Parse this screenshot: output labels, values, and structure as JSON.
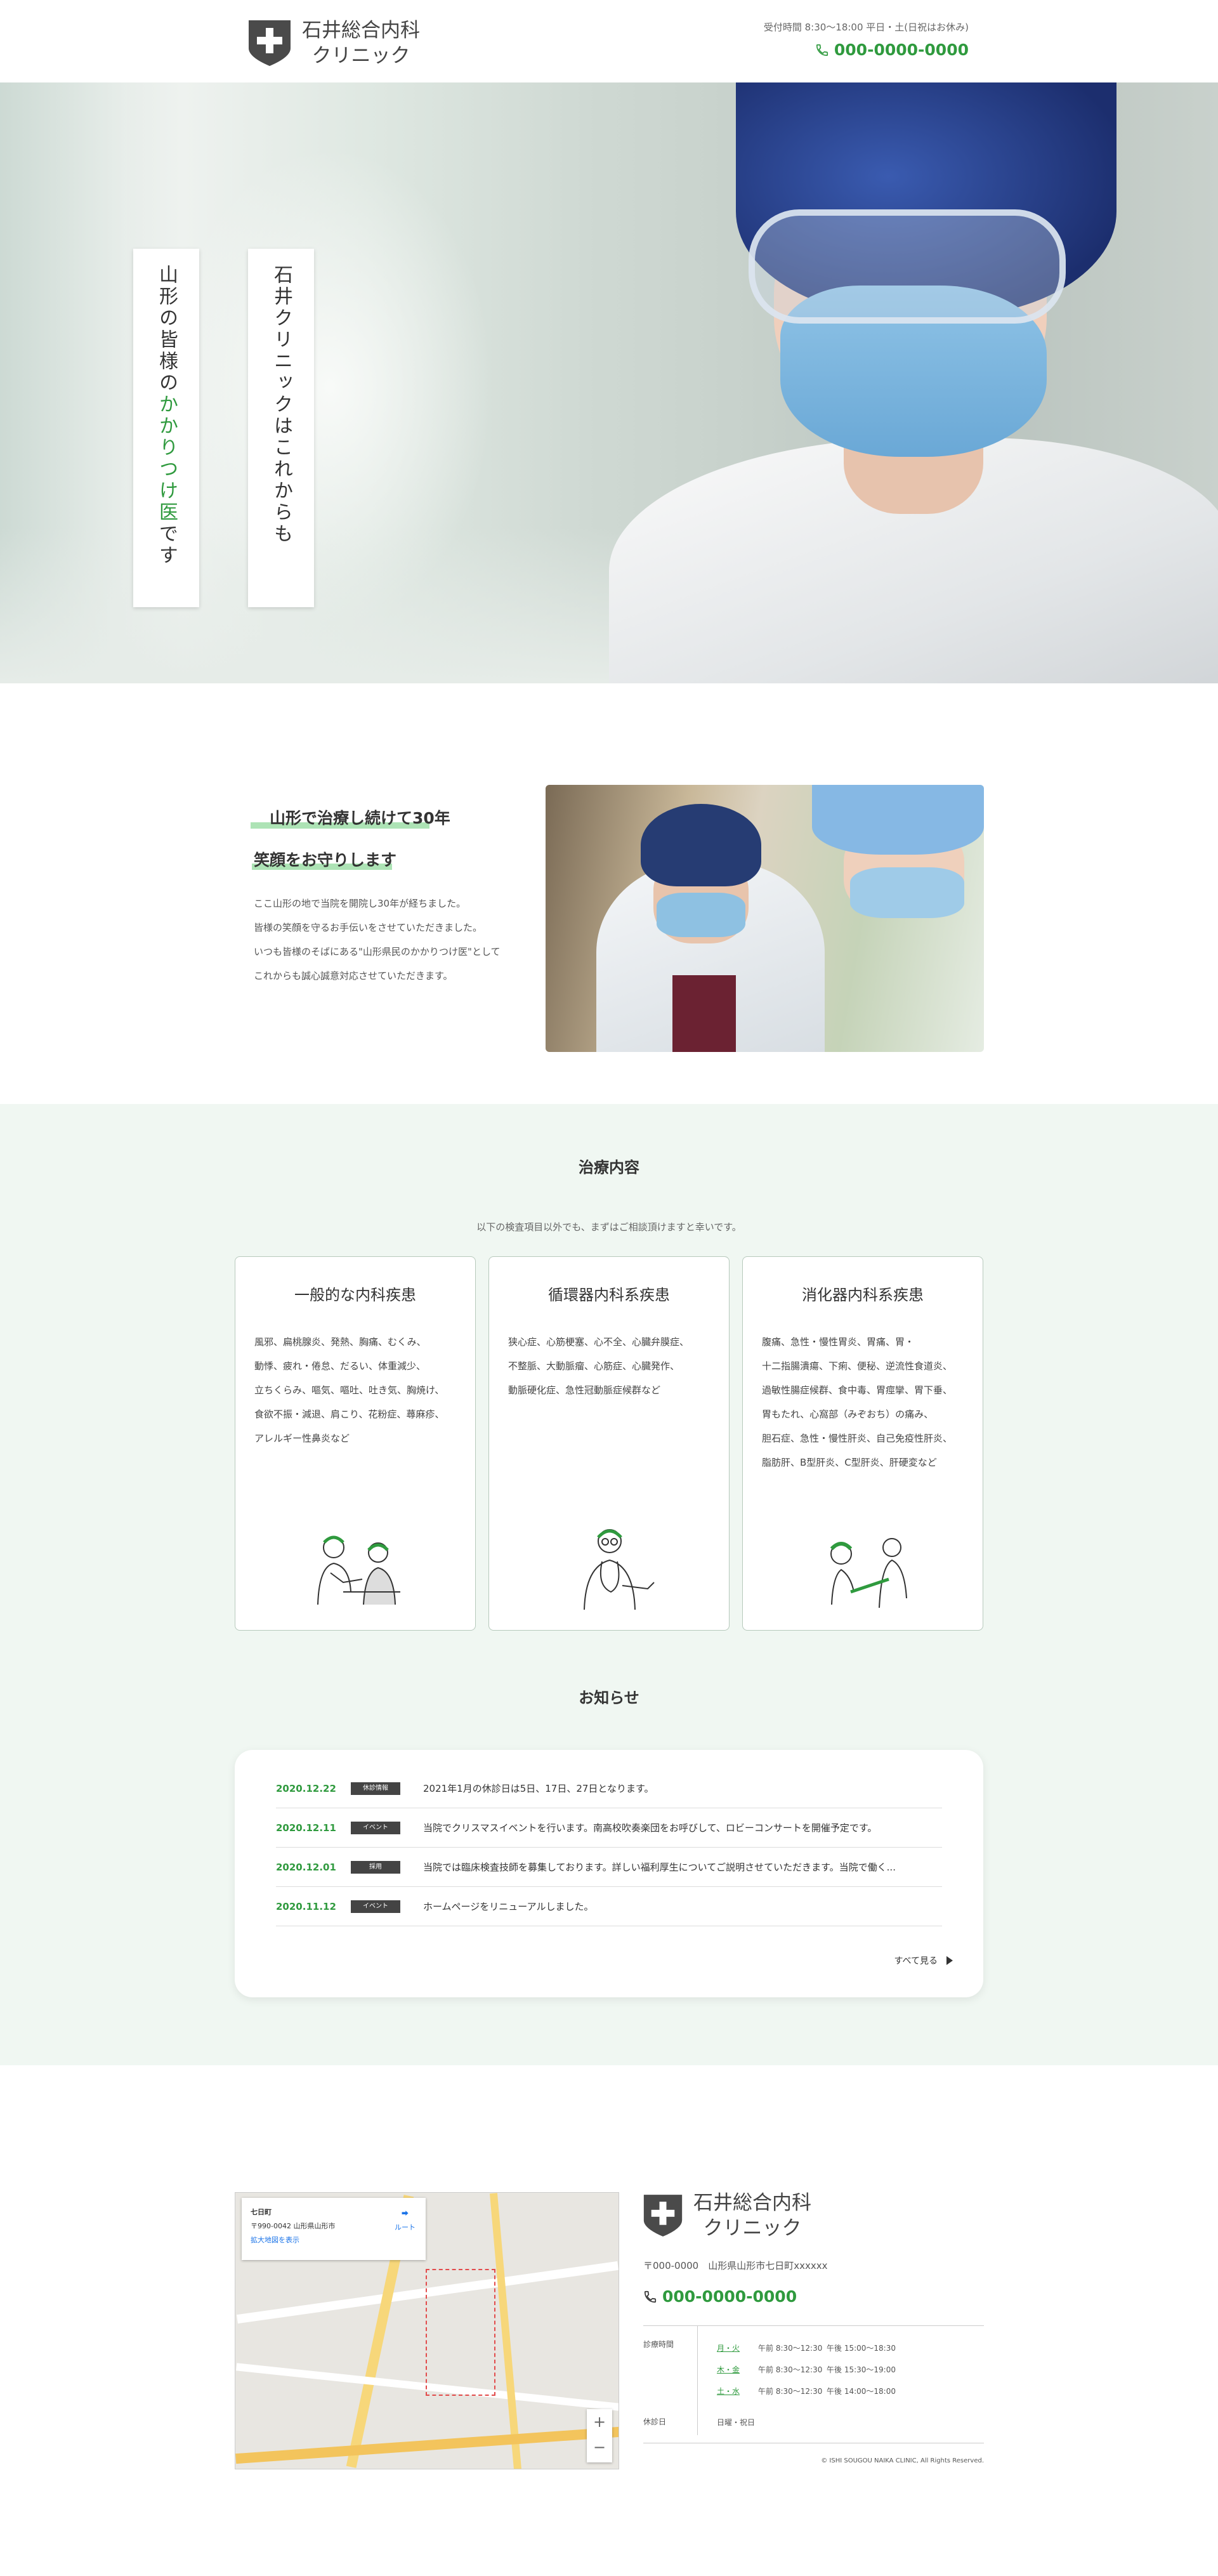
{
  "header": {
    "clinic_name_line1": "石井総合内科",
    "clinic_name_line2": "クリニック",
    "hours": "受付時間 8:30～18:00 平日・土(日祝はお休み)",
    "phone": "000-0000-0000"
  },
  "hero": {
    "vertical_text_left_pre": "山形の皆様の",
    "vertical_text_left_accent": "かかりつけ医",
    "vertical_text_left_post": "です",
    "vertical_text_right": "石井クリニックはこれからも"
  },
  "intro": {
    "title_line1": "山形で治療し続けて30年",
    "title_line2": "笑顔をお守りします",
    "body": [
      "ここ山形の地で当院を開院し30年が経ちました。",
      "皆様の笑顔を守るお手伝いをさせていただきました。",
      "いつも皆様のそばにある\"山形県民のかかりつけ医\"として",
      "これからも誠心誠意対応させていただきます。"
    ]
  },
  "services": {
    "title": "治療内容",
    "subtitle": "以下の検査項目以外でも、まずはご相談頂けますと幸いです。",
    "cards": [
      {
        "title": "一般的な内科疾患",
        "lines": [
          "風邪、扁桃腺炎、発熱、胸痛、むくみ、",
          "動悸、疲れ・倦怠、だるい、体重減少、",
          "立ちくらみ、嘔気、嘔吐、吐き気、胸焼け、",
          "食欲不振・減退、肩こり、花粉症、蕁麻疹、",
          "アレルギー性鼻炎など"
        ]
      },
      {
        "title": "循環器内科系疾患",
        "lines": [
          "狭心症、心筋梗塞、心不全、心臓弁膜症、",
          "不整脈、大動脈瘤、心筋症、心臓発作、",
          "動脈硬化症、急性冠動脈症候群など"
        ]
      },
      {
        "title": "消化器内科系疾患",
        "lines": [
          "腹痛、急性・慢性胃炎、胃痛、胃・",
          "十二指腸潰瘍、下痢、便秘、逆流性食道炎、",
          "過敏性腸症候群、食中毒、胃痙攣、胃下垂、",
          "胃もたれ、心窩部（みぞおち）の痛み、",
          "胆石症、急性・慢性肝炎、自己免疫性肝炎、",
          "脂肪肝、B型肝炎、C型肝炎、肝硬変など"
        ]
      }
    ]
  },
  "news": {
    "title": "お知らせ",
    "items": [
      {
        "date": "2020.12.22",
        "tag": "休診情報",
        "text": "2021年1月の休診日は5日、17日、27日となります。"
      },
      {
        "date": "2020.12.11",
        "tag": "イベント",
        "text": "当院でクリスマスイベントを行います。南高校吹奏楽団をお呼びして、ロビーコンサートを開催予定です。"
      },
      {
        "date": "2020.12.01",
        "tag": "採用",
        "text": "当院では臨床検査技師を募集しております。詳しい福利厚生についてご説明させていただきます。当院で働く..."
      },
      {
        "date": "2020.11.12",
        "tag": "イベント",
        "text": "ホームページをリニューアルしました。"
      }
    ],
    "more": "すべて見る"
  },
  "map": {
    "place": "七日町",
    "address": "〒990-0042 山形県山形市",
    "enlarge": "拡大地図を表示",
    "route": "ルート",
    "zoom_in": "+",
    "zoom_out": "−"
  },
  "footer": {
    "clinic_name_line1": "石井総合内科",
    "clinic_name_line2": "クリニック",
    "address": "〒000-0000　山形県山形市七日町xxxxxx",
    "phone": "000-0000-0000",
    "hours_label": "診療時間",
    "hours": [
      {
        "day": "月・火",
        "am": "午前 8:30～12:30",
        "pm": "午後 15:00～18:30"
      },
      {
        "day": "木・金",
        "am": "午前 8:30～12:30",
        "pm": "午後 15:30～19:00"
      },
      {
        "day": "土・水",
        "am": "午前 8:30～12:30",
        "pm": "午後 14:00～18:00"
      }
    ],
    "holiday_label": "休診日",
    "holiday": "日曜・祝日",
    "copyright": "© ISHI SOUGOU NAIKA CLINIC, All Rights Reserved."
  },
  "colors": {
    "accent": "#2f9a3e",
    "highlight": "#9fdea8",
    "band": "#f0f7f2"
  }
}
